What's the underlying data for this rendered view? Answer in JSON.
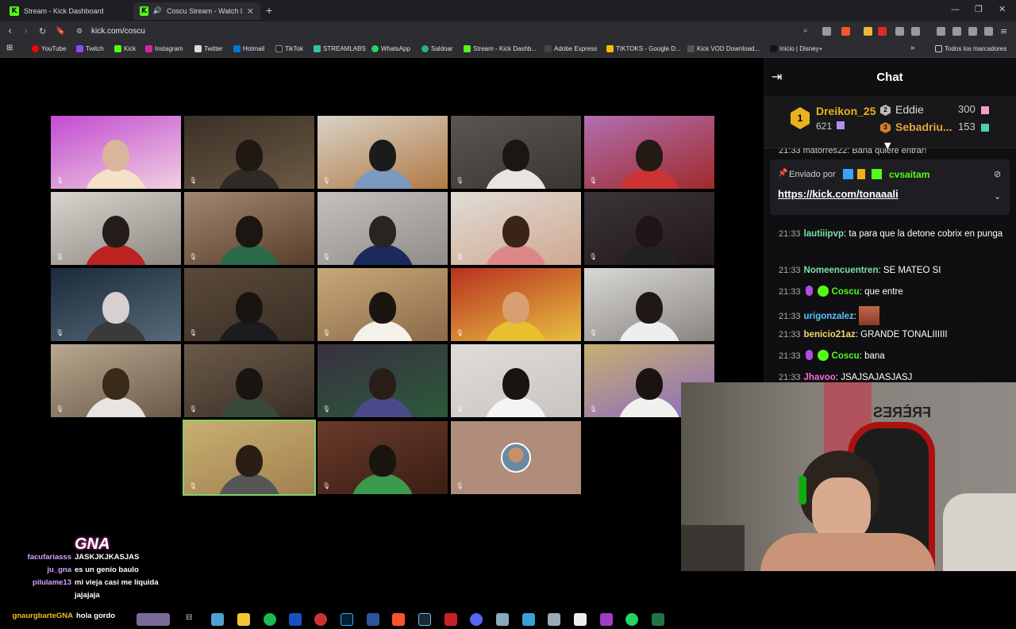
{
  "tabs": [
    {
      "title": "Stream - Kick Dashboard",
      "active": false
    },
    {
      "title": "Coscu Stream - Watch Live on",
      "active": true
    }
  ],
  "address": {
    "url": "kick.com/coscu"
  },
  "bookmarks": [
    "YouTube",
    "Twitch",
    "Kick",
    "Instagram",
    "Twitter",
    "Hotmail",
    "TikTok",
    "STREAMLABS",
    "WhatsApp",
    "Saldoar",
    "Stream - Kick Dashb...",
    "Adobe Express",
    "TIKTOKS - Google D...",
    "Kick VOD Download...",
    "Inicio | Disney+"
  ],
  "bookmarks_folder": "Todos los marcadores",
  "chat": {
    "title": "Chat",
    "leaderboard": [
      {
        "rank": "1",
        "name": "Dreikon_25",
        "count": "621"
      },
      {
        "rank": "2",
        "name": "Eddie",
        "count": "300"
      },
      {
        "rank": "3",
        "name": "Sebadriu...",
        "count": "153"
      }
    ],
    "partial_line": "21:33 matorres22: Bana quiere entrar!",
    "pinned": {
      "sent_by": "Enviado por",
      "user": "cvsaitam",
      "link": "https://kick.com/tonaaali"
    },
    "messages": [
      {
        "time": "21:33",
        "user": "lautiiipvp",
        "text": "ta para que la detone cobrix en punga",
        "color": "#7ee0a4"
      },
      {
        "time": "21:33",
        "user": "Nomeencuentren",
        "text": "SE MATEO SI",
        "color": "#7ee0a4"
      },
      {
        "time": "21:33",
        "user": "Coscu",
        "text": "que entre",
        "color": "#53fc18"
      },
      {
        "time": "21:33",
        "user": "urigonzalez",
        "text": "",
        "color": "#53c6fc"
      },
      {
        "time": "21:33",
        "user": "benicio21az",
        "text": "GRANDE TONALIIIIII",
        "color": "#f5d76e"
      },
      {
        "time": "21:33",
        "user": "Coscu",
        "text": "bana",
        "color": "#53fc18"
      },
      {
        "time": "21:33",
        "user": "Jhavoo",
        "text": "JSAJSAJASJASJ",
        "color": "#fc6bd8"
      }
    ]
  },
  "overlay_chat": {
    "logo": "GNA",
    "lines": [
      {
        "user": "facufariasss",
        "text": "JASKJKJKASJAS"
      },
      {
        "user": "ju_gna",
        "text": "es un genio baulo"
      },
      {
        "user": "pilulame13",
        "text": "mi vieja casi me liquida"
      },
      {
        "user": "",
        "text": "jajajaja"
      },
      {
        "user": "gnaurgbarteGNA",
        "text": "hola gordo"
      }
    ]
  },
  "webcam_sign": "FRÈRES",
  "colors": {
    "kick_green": "#53fc18",
    "panel_bg": "#0f0f11"
  }
}
